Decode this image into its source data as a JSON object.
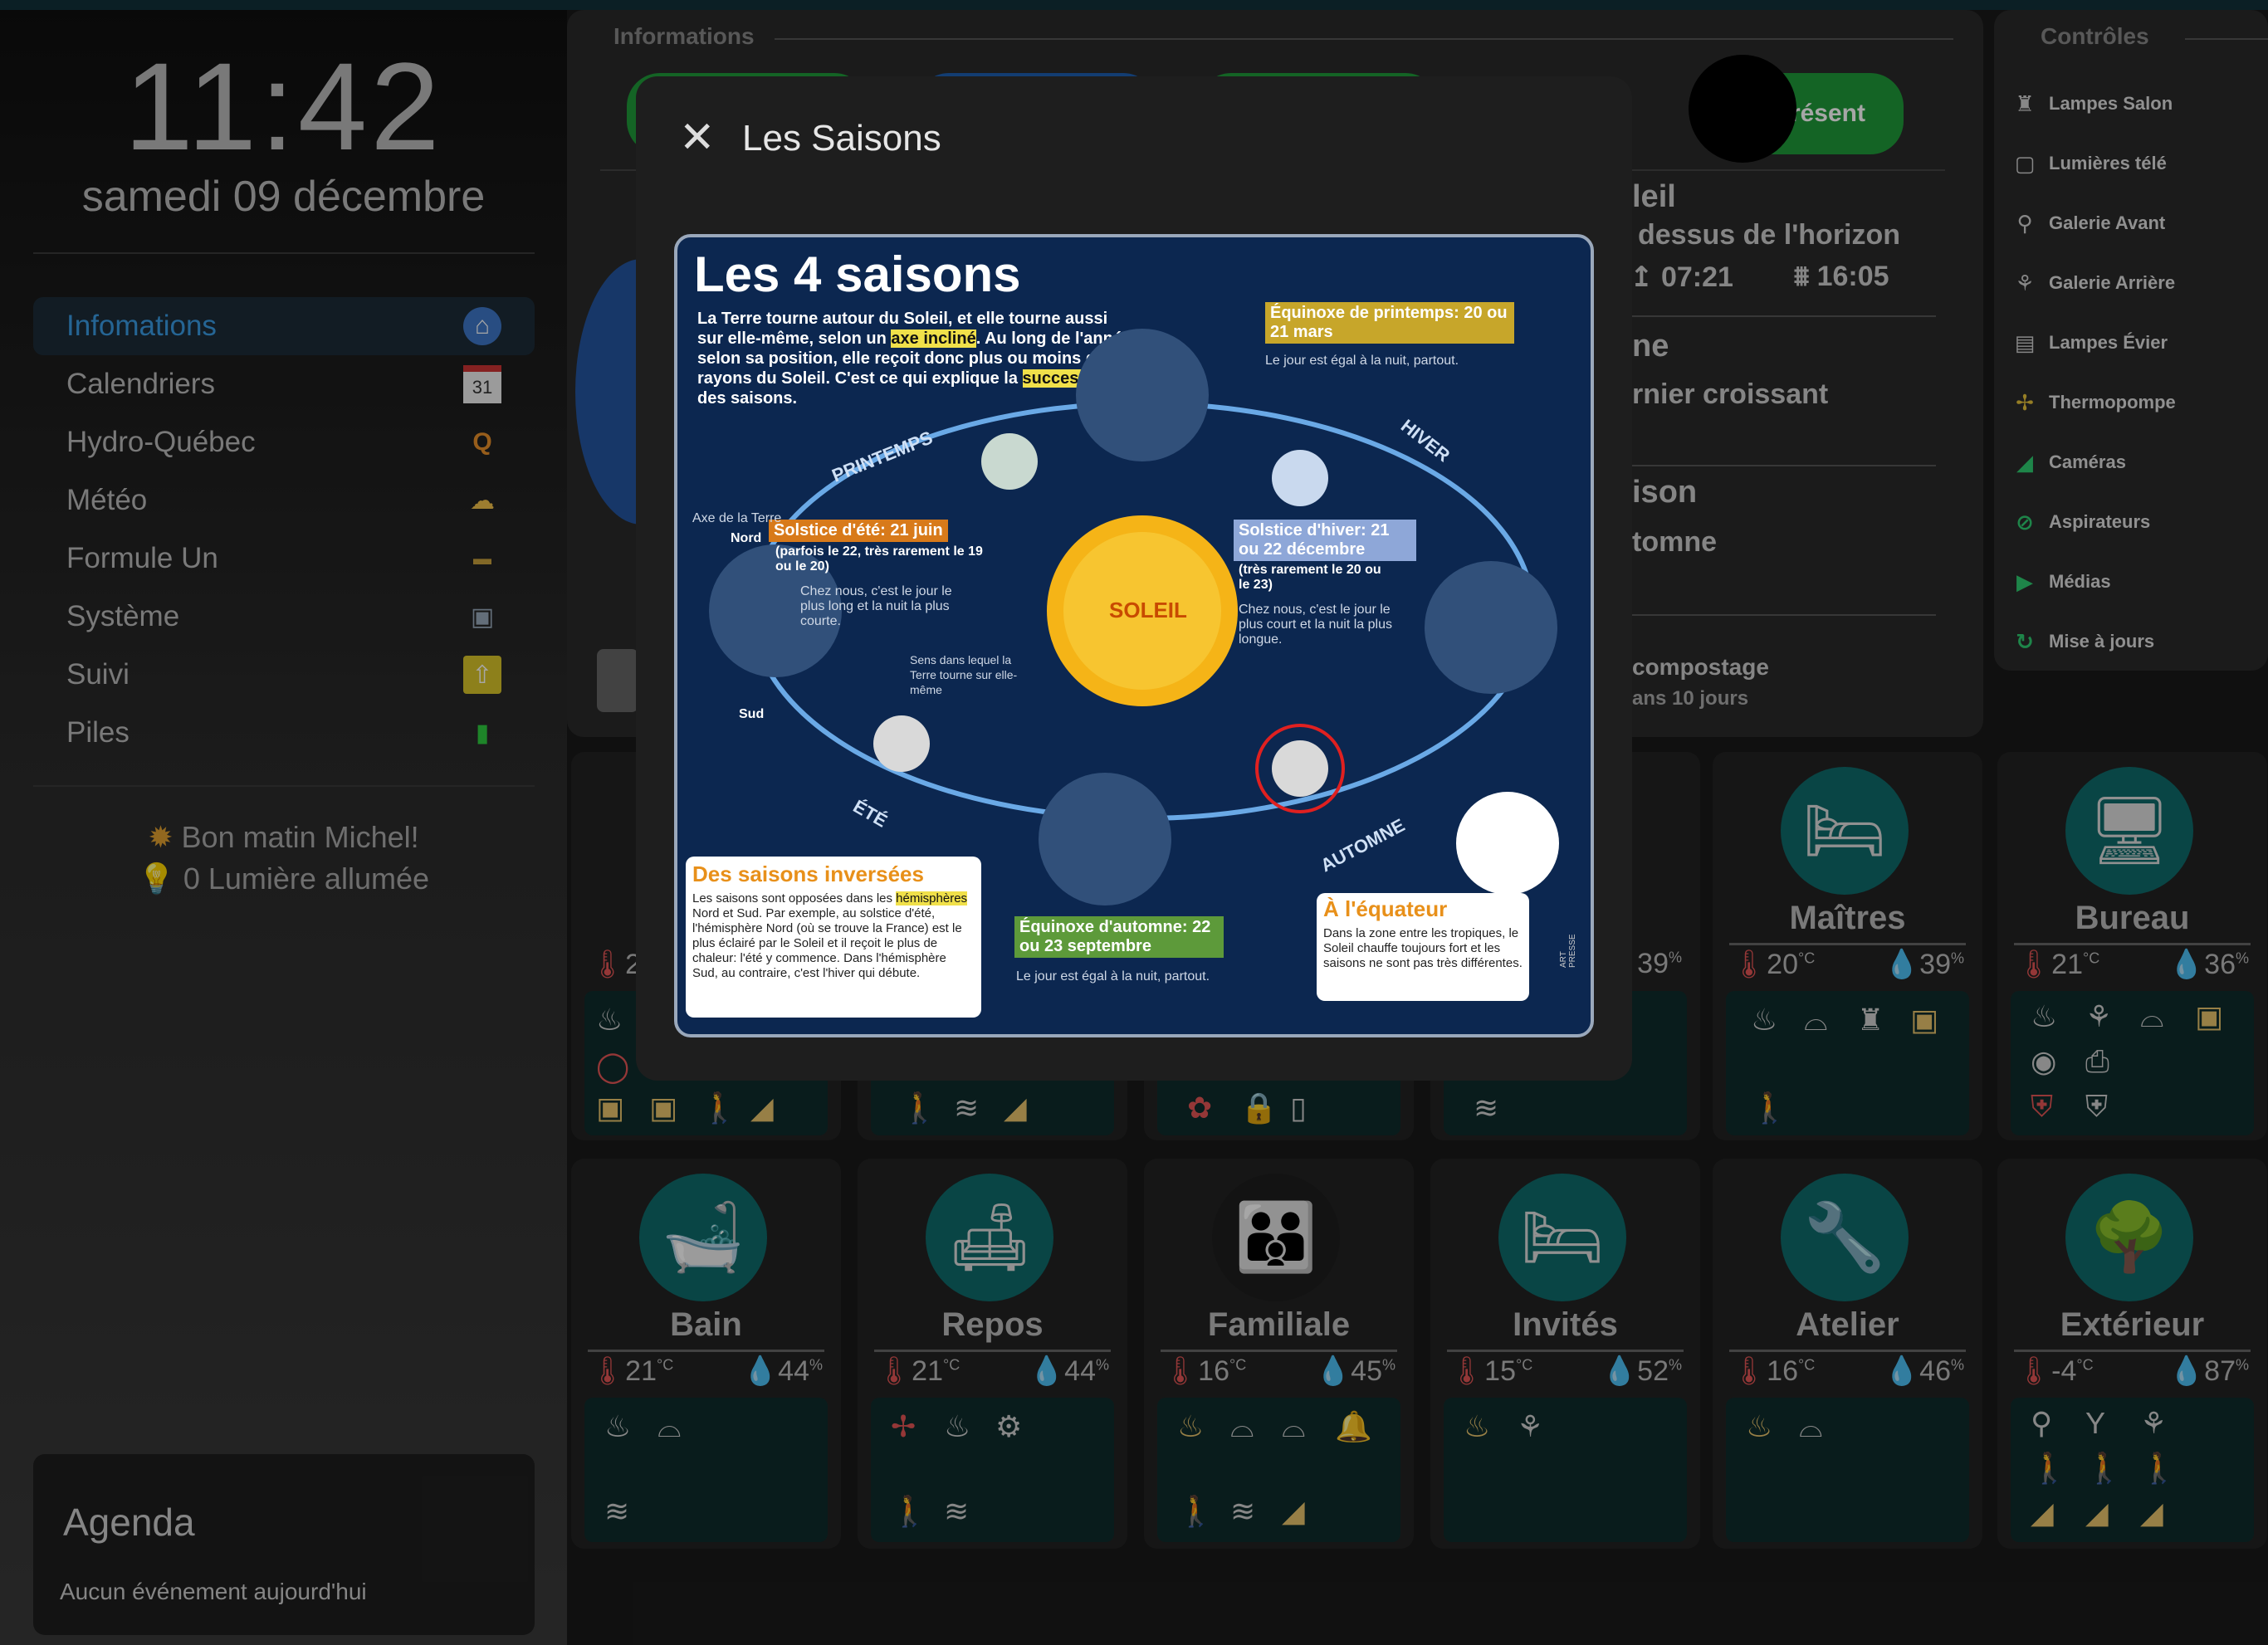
{
  "clock": {
    "time": "11:42",
    "date": "samedi 09 décembre"
  },
  "nav": [
    {
      "label": "Infomations",
      "icon": "home-icon",
      "glyph": "⌂"
    },
    {
      "label": "Calendriers",
      "icon": "calendar-icon",
      "glyph": "31"
    },
    {
      "label": "Hydro-Québec",
      "icon": "hydro-icon",
      "glyph": "Q"
    },
    {
      "label": "Météo",
      "icon": "weather-icon",
      "glyph": "⛅"
    },
    {
      "label": "Formule Un",
      "icon": "formula-car-icon",
      "glyph": "🏎"
    },
    {
      "label": "Système",
      "icon": "computer-icon",
      "glyph": "🖥"
    },
    {
      "label": "Suivi",
      "icon": "upload-icon",
      "glyph": "⇧"
    },
    {
      "label": "Piles",
      "icon": "battery-icon",
      "glyph": "▮"
    }
  ],
  "greeting": {
    "line1": "Bon matin Michel!",
    "line2": "0 Lumière allumée"
  },
  "agenda": {
    "title": "Agenda",
    "empty": "Aucun événement aujourd'hui"
  },
  "info": {
    "title": "Informations",
    "presence": "Présent",
    "sun_title": "leil",
    "sun_sub": "dessus de l'horizon",
    "sunrise": "07:21",
    "sunset": "16:05",
    "moon_title": "ne",
    "moon_phase": "rnier croissant",
    "season_title": "ison",
    "season_value": "tomne",
    "compost_title": "compostage",
    "compost_value": "ans 10 jours"
  },
  "controls": {
    "title": "Contrôles",
    "items": [
      {
        "label": "Lampes Salon",
        "icon": "lamp-icon",
        "glyph": "🛋"
      },
      {
        "label": "Lumières télé",
        "icon": "tv-light-icon",
        "glyph": "▢"
      },
      {
        "label": "Galerie Avant",
        "icon": "porch-light-icon",
        "glyph": "⚲"
      },
      {
        "label": "Galerie Arrière",
        "icon": "ceiling-light-icon",
        "glyph": "⚘"
      },
      {
        "label": "Lampes Évier",
        "icon": "sink-light-icon",
        "glyph": "▤"
      },
      {
        "label": "Thermopompe",
        "icon": "heat-pump-icon",
        "glyph": "✢"
      },
      {
        "label": "Caméras",
        "icon": "camera-icon",
        "glyph": "◢"
      },
      {
        "label": "Aspirateurs",
        "icon": "vacuum-icon",
        "glyph": "⊘"
      },
      {
        "label": "Médias",
        "icon": "play-icon",
        "glyph": "▶"
      },
      {
        "label": "Mise à jours",
        "icon": "update-icon",
        "glyph": "↻"
      }
    ]
  },
  "rooms_top": [
    {
      "name": "Maîtres",
      "temp": "20",
      "hum": "39",
      "icon": "bed-icon",
      "glyph": "🛏"
    },
    {
      "name": "Bureau",
      "temp": "21",
      "hum": "36",
      "icon": "desk-icon",
      "glyph": "🖥"
    }
  ],
  "rooms_partial": [
    {
      "temp": "2"
    },
    {
      "hum": "39"
    }
  ],
  "rooms_bottom": [
    {
      "name": "Bain",
      "temp": "21",
      "hum": "44",
      "icon": "bath-icon",
      "glyph": "🛁"
    },
    {
      "name": "Repos",
      "temp": "21",
      "hum": "44",
      "icon": "armchair-icon",
      "glyph": "🛋"
    },
    {
      "name": "Familiale",
      "temp": "16",
      "hum": "45",
      "icon": "family-icon",
      "glyph": "👪"
    },
    {
      "name": "Invités",
      "temp": "15",
      "hum": "52",
      "icon": "guest-bed-icon",
      "glyph": "🛏"
    },
    {
      "name": "Atelier",
      "temp": "16",
      "hum": "46",
      "icon": "tools-icon",
      "glyph": "🔧"
    },
    {
      "name": "Extérieur",
      "temp": "-4",
      "hum": "87",
      "icon": "tree-icon",
      "glyph": "🌳"
    }
  ],
  "units": {
    "celsius": "°C",
    "percent": "%"
  },
  "modal": {
    "title": "Les Saisons",
    "poster": {
      "heading": "Les 4 saisons",
      "intro_a": "La Terre tourne autour du Soleil, et elle tourne aussi sur elle-même, selon un ",
      "intro_hl1": "axe incliné",
      "intro_b": ". Au long de l'année, selon sa position, elle reçoit donc plus ou moins de rayons du Soleil. C'est ce qui explique la ",
      "intro_hl2": "succession",
      "intro_c": " des saisons.",
      "printemps": "PRINTEMPS",
      "hiver": "HIVER",
      "ete": "ÉTÉ",
      "automne": "AUTOMNE",
      "soleil": "SOLEIL",
      "equinox_spring": "Équinoxe de printemps: 20 ou 21 mars",
      "equinox_spring_note": "Le jour est égal à la nuit, partout.",
      "solstice_summer": "Solstice d'été: 21 juin",
      "solstice_summer_sub": "(parfois le 22, très rarement le 19 ou le 20)",
      "solstice_summer_note": "Chez nous, c'est le jour le plus long et la nuit la plus courte.",
      "solstice_winter": "Solstice d'hiver: 21 ou 22 décembre",
      "solstice_winter_sub": "(très rarement le 20 ou le 23)",
      "solstice_winter_note": "Chez nous, c'est le jour le plus court et la nuit la plus longue.",
      "axis": "Axe de la Terre",
      "nord": "Nord",
      "sud": "Sud",
      "rotation": "Sens dans lequel la Terre tourne sur elle-même",
      "equinox_fall": "Équinoxe d'automne: 22 ou 23 septembre",
      "equinox_fall_note": "Le jour est égal à la nuit, partout.",
      "inverted_title": "Des saisons inversées",
      "inverted_text_a": "Les saisons sont opposées dans les ",
      "inverted_hl": "hémisphères",
      "inverted_text_b": " Nord et Sud. Par exemple, au solstice d'été, l'hémisphère Nord (où se trouve la France) est le plus éclairé par le Soleil et il reçoit le plus de chaleur: l'été y commence. Dans l'hémisphère Sud, au contraire, c'est l'hiver qui débute.",
      "equator_title": "À l'équateur",
      "equator_text": "Dans la zone entre les tropiques, le Soleil chauffe toujours fort et les saisons ne sont pas très différentes.",
      "credit": "ART PRESSE"
    }
  }
}
